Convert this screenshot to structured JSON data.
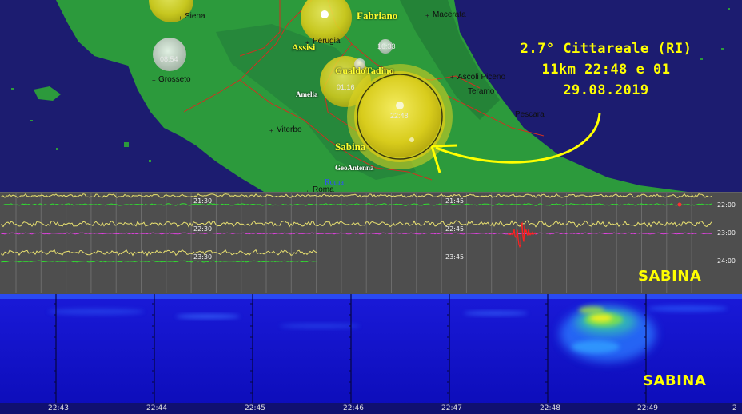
{
  "map": {
    "cities": [
      "Siena",
      "Macerata",
      "Perugia",
      "Grosseto",
      "Ascoli Piceno",
      "Teramo",
      "Pescara",
      "Viterbo",
      "Roma"
    ],
    "stations": [
      "Fabriano",
      "Assisi",
      "GualdoTadino",
      "Amelia",
      "Sabina",
      "GeoAntenna",
      "Roma"
    ],
    "bubble_times": [
      "08:54",
      "16:33",
      "01:16",
      "22:48"
    ],
    "annotation": {
      "line1": "2.7° Cittareale (RI)",
      "line2": "11km 22:48 e 01",
      "line3": "29.08.2019"
    },
    "colors": {
      "sea": "#1c1c70",
      "land": "#2c9a3c",
      "bubble": "#e8d820",
      "annotation": "#ffff00"
    }
  },
  "helicorder": {
    "time_marks": [
      "21:30",
      "21:45",
      "22:30",
      "22:45",
      "23:30",
      "23:45"
    ],
    "hour_labels": [
      "22:00",
      "23:00",
      "24:00"
    ],
    "station_label": "SABINA",
    "colors": {
      "trace": "#e8e070",
      "green": "#30e030",
      "magenta": "#e040e0",
      "event": "#ff2020"
    }
  },
  "spectrogram": {
    "station_label": "SABINA",
    "time_ticks": [
      "22:43",
      "22:44",
      "22:45",
      "22:46",
      "22:47",
      "22:48",
      "22:49",
      "2"
    ],
    "colors": {
      "background": "#1414c8",
      "event_core": "#f0f020",
      "event_mid": "#30c070"
    }
  }
}
